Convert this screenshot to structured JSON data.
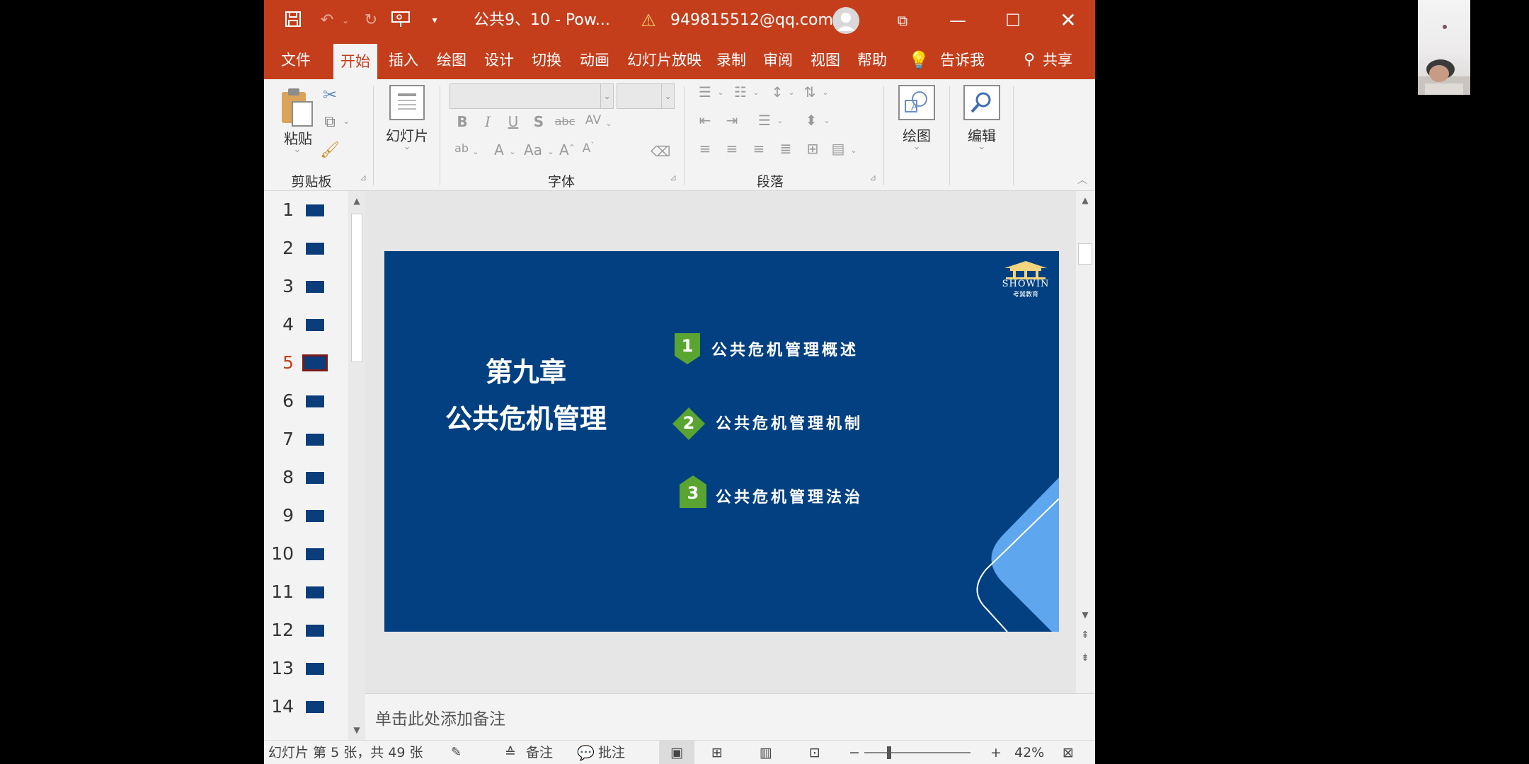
{
  "titlebar": {
    "doc_title": "公共9、10  -  Pow...",
    "account": "949815512@qq.com"
  },
  "tabs": [
    "文件",
    "开始",
    "插入",
    "绘图",
    "设计",
    "切换",
    "动画",
    "幻灯片放映",
    "录制",
    "审阅",
    "视图",
    "帮助"
  ],
  "tell_me": "告诉我",
  "share": "共享",
  "ribbon": {
    "paste": "粘贴",
    "clipboard": "剪贴板",
    "slides": "幻灯片",
    "font": "字体",
    "paragraph": "段落",
    "drawing": "绘图",
    "editing": "编辑"
  },
  "thumbnails": [
    {
      "num": "1"
    },
    {
      "num": "2"
    },
    {
      "num": "3"
    },
    {
      "num": "4"
    },
    {
      "num": "5",
      "selected": true
    },
    {
      "num": "6"
    },
    {
      "num": "7"
    },
    {
      "num": "8"
    },
    {
      "num": "9"
    },
    {
      "num": "10"
    },
    {
      "num": "11"
    },
    {
      "num": "12"
    },
    {
      "num": "13"
    },
    {
      "num": "14"
    }
  ],
  "slide": {
    "chapter": "第九章",
    "title": "公共危机管理",
    "logo_text": "SHOWIN",
    "logo_sub": "考翼教育",
    "items": [
      {
        "num": "1",
        "text": "公共危机管理概述"
      },
      {
        "num": "2",
        "text": "公共危机管理机制"
      },
      {
        "num": "3",
        "text": "公共危机管理法治"
      }
    ],
    "bg_color": "#034081",
    "accent_color": "#5aa531"
  },
  "notes_placeholder": "单击此处添加备注",
  "status": {
    "slide_info": "幻灯片 第 5 张，共 49 张",
    "notes": "备注",
    "comments": "批注",
    "zoom": "42%"
  }
}
